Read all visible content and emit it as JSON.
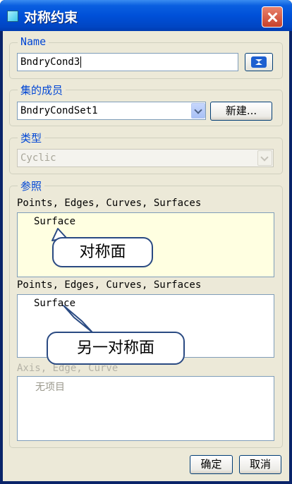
{
  "window": {
    "title": "对称约束"
  },
  "name_group": {
    "label": "Name",
    "value": "BndryCond3"
  },
  "set_group": {
    "label": "集的成员",
    "selected": "BndryCondSet1",
    "new_button": "新建..."
  },
  "type_group": {
    "label": "类型",
    "selected": "Cyclic"
  },
  "ref_group": {
    "label": "参照",
    "list1": {
      "caption": "Points, Edges, Curves, Surfaces",
      "item": "Surface",
      "callout": "对称面"
    },
    "list2": {
      "caption": "Points, Edges, Curves, Surfaces",
      "item": "Surface",
      "callout": "另一对称面"
    },
    "list3": {
      "caption": "Axis, Edge, Curve",
      "empty_text": "无项目"
    }
  },
  "buttons": {
    "ok": "确定",
    "cancel": "取消"
  },
  "colors": {
    "titlebar": "#0050d8",
    "group_label": "#0046d5",
    "selected_list_bg": "#ffffe1",
    "dialog_bg": "#ece9d8"
  }
}
